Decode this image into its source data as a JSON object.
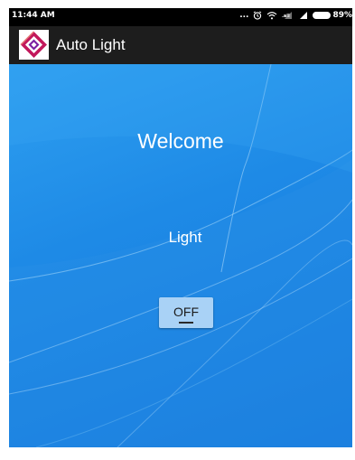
{
  "status_bar": {
    "time": "11:44 AM",
    "dots": "...",
    "battery": "89%"
  },
  "action_bar": {
    "title": "Auto Light",
    "logo_icon": "diamond-logo-icon"
  },
  "main": {
    "welcome": "Welcome",
    "light_label": "Light",
    "toggle": {
      "label": "OFF",
      "state": "off"
    }
  },
  "colors": {
    "status_bar": "#000000",
    "action_bar": "#1d1d1d",
    "background": "#1e8ae6",
    "toggle_bg": "#a9d2f6",
    "logo_accent": "#c2185b"
  }
}
